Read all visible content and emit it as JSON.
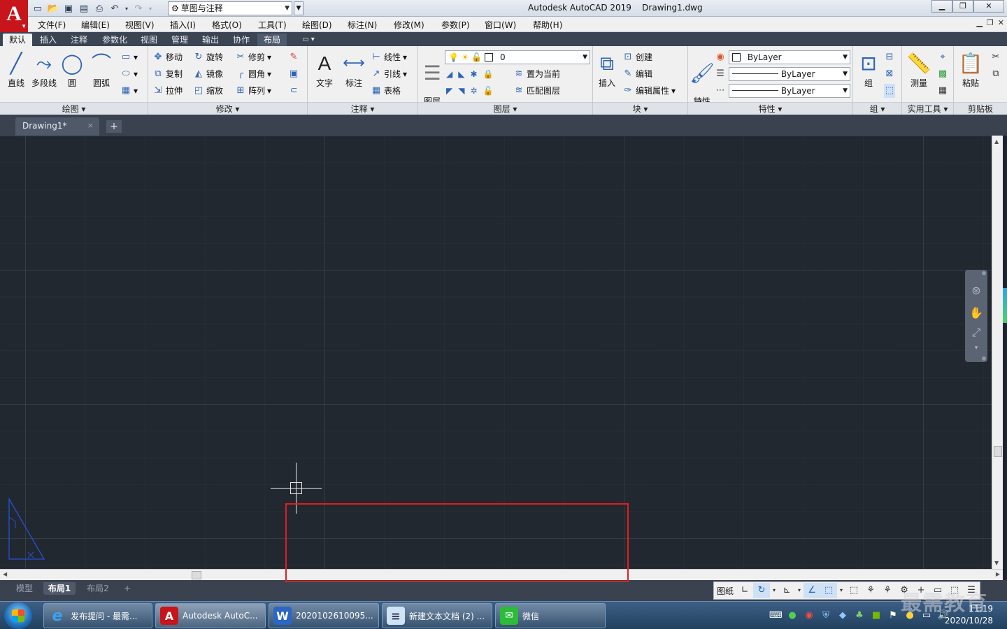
{
  "app": {
    "logo_letter": "A",
    "workspace": "草图与注释",
    "window_title": "Autodesk AutoCAD 2019    Drawing1.dwg",
    "brand_color": "#c7151b"
  },
  "menu": [
    "文件(F)",
    "编辑(E)",
    "视图(V)",
    "插入(I)",
    "格式(O)",
    "工具(T)",
    "绘图(D)",
    "标注(N)",
    "修改(M)",
    "参数(P)",
    "窗口(W)",
    "帮助(H)"
  ],
  "ribbon_tabs": [
    "默认",
    "插入",
    "注释",
    "参数化",
    "视图",
    "管理",
    "输出",
    "协作",
    "布局"
  ],
  "ribbon_tab_extra": "▭ ▾",
  "panels": {
    "draw": {
      "title": "绘图 ▾",
      "line": "直线",
      "polyline": "多段线",
      "circle": "圆",
      "arc": "圆弧"
    },
    "modify": {
      "title": "修改 ▾",
      "move": "移动",
      "rotate": "旋转",
      "trim": "修剪",
      "copy": "复制",
      "mirror": "镜像",
      "fillet": "圆角",
      "stretch": "拉伸",
      "scale": "缩放",
      "array": "阵列"
    },
    "annotation": {
      "title": "注释 ▾",
      "text": "文字",
      "dimension": "标注",
      "linear": "线性",
      "leader": "引线",
      "table": "表格"
    },
    "layers": {
      "title": "图层 ▾",
      "layer_props": "图层\n特性",
      "current_layer": "0",
      "set_current": "置为当前",
      "match_layer": "匹配图层"
    },
    "block": {
      "title": "块 ▾",
      "insert": "插入",
      "create": "创建",
      "edit": "编辑",
      "edit_attr": "编辑属性"
    },
    "properties": {
      "title": "特性 ▾",
      "match_props": "特性\n匹配",
      "color": "ByLayer",
      "linetype": "ByLayer",
      "lineweight": "ByLayer"
    },
    "groups": {
      "title": "组 ▾",
      "group": "组"
    },
    "utilities": {
      "title": "实用工具 ▾",
      "measure": "测量"
    },
    "clipboard": {
      "title": "剪贴板",
      "paste": "粘贴"
    }
  },
  "file_tab": {
    "name": "Drawing1*",
    "close": "×",
    "new": "+"
  },
  "layout_tabs": [
    "模型",
    "布局1",
    "布局2",
    "+"
  ],
  "status_bar": {
    "paper": "图纸"
  },
  "taskbar": {
    "items": [
      {
        "label": "发布提问 - 最需...",
        "icon": "e"
      },
      {
        "label": "Autodesk AutoC...",
        "icon": "A"
      },
      {
        "label": "2020102610095...",
        "icon": "W"
      },
      {
        "label": "新建文本文档 (2) ...",
        "icon": "≡"
      },
      {
        "label": "微信",
        "icon": "✉"
      }
    ],
    "clock_time": "11:19",
    "clock_date": "2020/10/28"
  },
  "watermark": "最需教育"
}
